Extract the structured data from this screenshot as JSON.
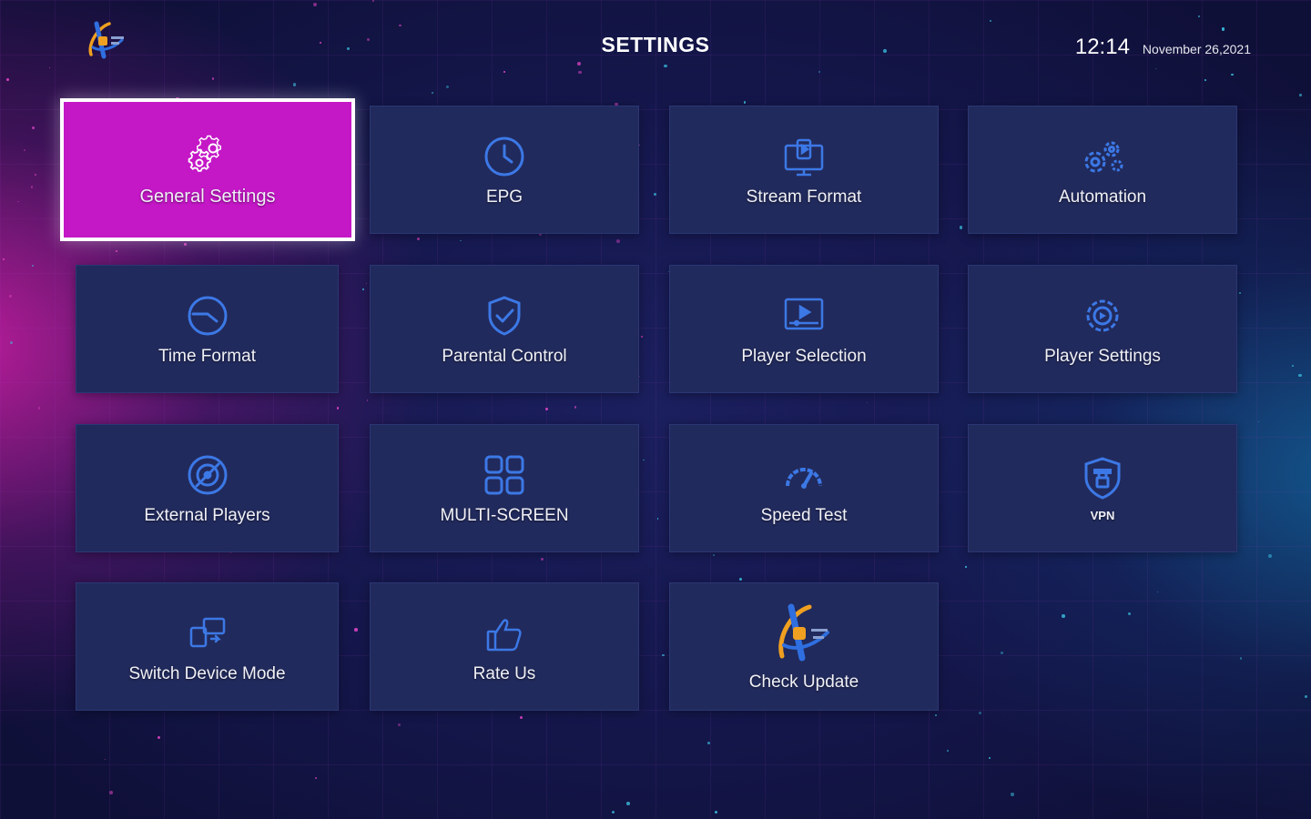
{
  "header": {
    "title": "SETTINGS",
    "time": "12:14",
    "date": "November 26,2021"
  },
  "colors": {
    "tile_bg": "#212a5c",
    "selected_bg": "#c417c6",
    "icon_blue": "#3c78e6",
    "text": "#ffffff"
  },
  "tiles": [
    {
      "label": "General Settings",
      "icon": "gear-icon",
      "selected": true
    },
    {
      "label": "EPG",
      "icon": "clock-icon"
    },
    {
      "label": "Stream Format",
      "icon": "stream-monitor-icon"
    },
    {
      "label": "Automation",
      "icon": "gears-icon"
    },
    {
      "label": "Time Format",
      "icon": "time-icon"
    },
    {
      "label": "Parental Control",
      "icon": "shield-check-icon"
    },
    {
      "label": "Player Selection",
      "icon": "player-screen-icon"
    },
    {
      "label": "Player Settings",
      "icon": "player-gear-icon"
    },
    {
      "label": "External Players",
      "icon": "external-player-icon"
    },
    {
      "label": "MULTI-SCREEN",
      "icon": "multi-screen-icon"
    },
    {
      "label": "Speed Test",
      "icon": "speedometer-icon"
    },
    {
      "label": "VPN",
      "icon": "vpn-shield-icon"
    },
    {
      "label": "Switch Device Mode",
      "icon": "switch-device-icon"
    },
    {
      "label": "Rate Us",
      "icon": "thumbs-up-icon"
    },
    {
      "label": "Check Update",
      "icon": "app-logo-icon"
    }
  ]
}
